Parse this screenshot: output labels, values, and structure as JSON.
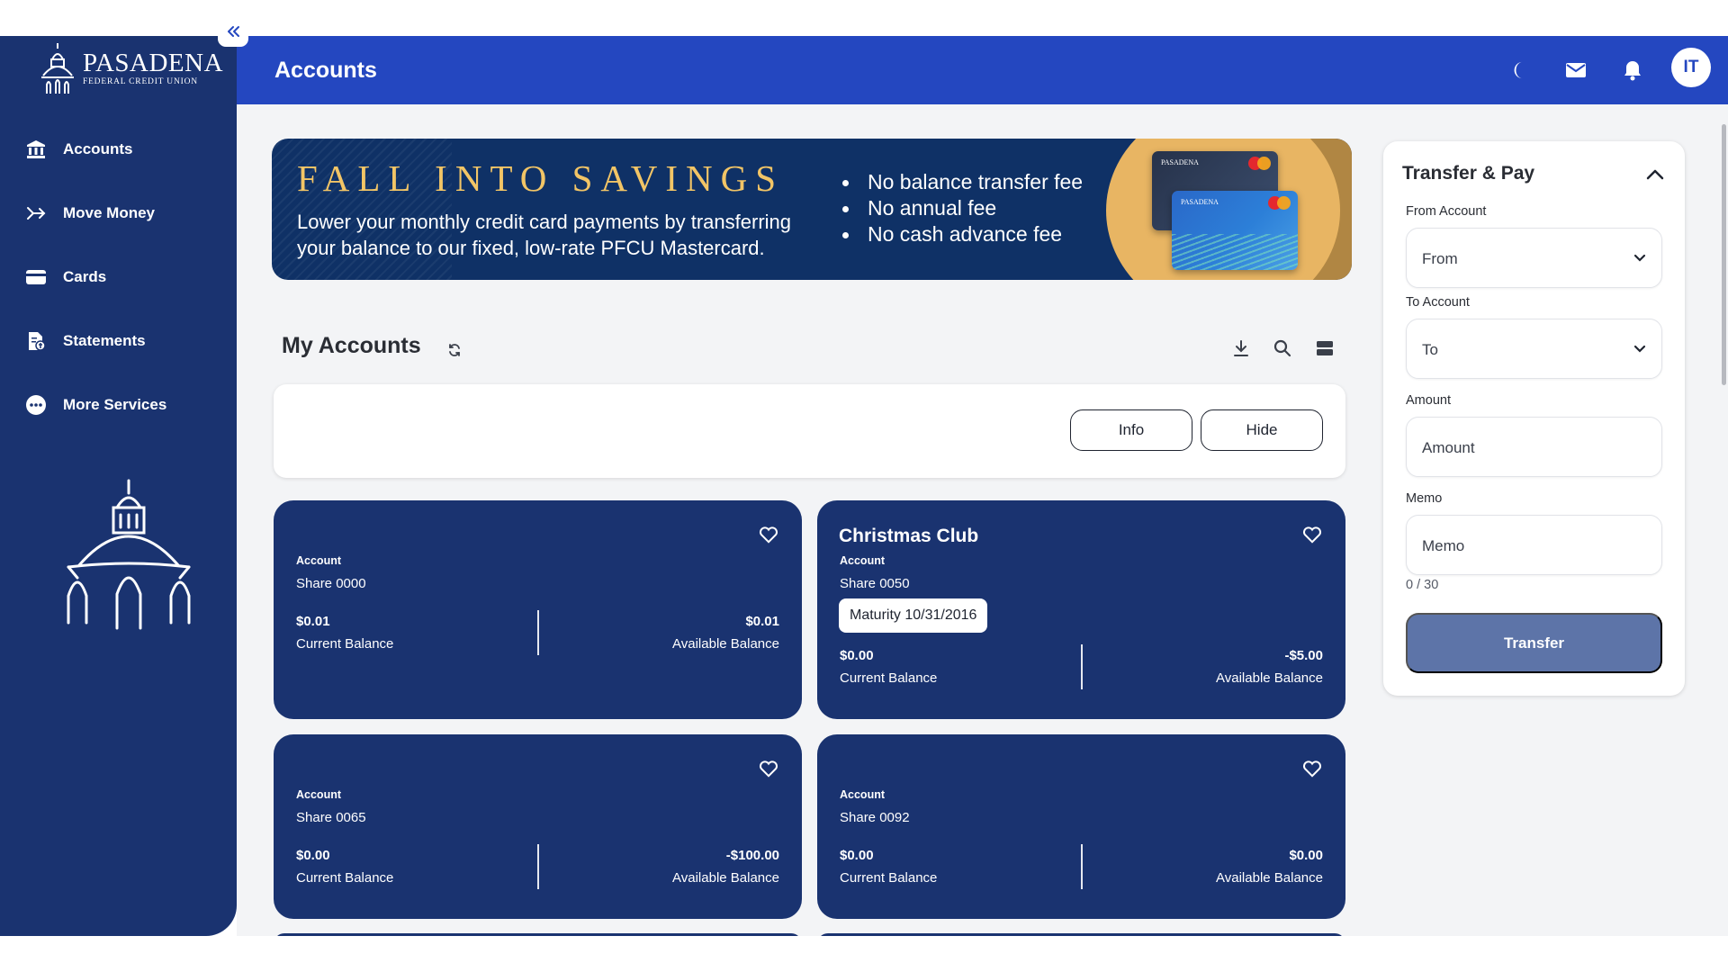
{
  "brand": {
    "name": "PASADENA",
    "tagline": "FEDERAL CREDIT UNION"
  },
  "sidebar": {
    "items": [
      {
        "label": "Accounts",
        "icon": "bank-icon"
      },
      {
        "label": "Move Money",
        "icon": "move-money-icon"
      },
      {
        "label": "Cards",
        "icon": "credit-card-icon"
      },
      {
        "label": "Statements",
        "icon": "statement-icon"
      },
      {
        "label": "More Services",
        "icon": "more-icon"
      }
    ]
  },
  "header": {
    "title": "Accounts",
    "avatar_initials": "IT",
    "icons": [
      "dark-mode-icon",
      "mail-icon",
      "bell-icon"
    ]
  },
  "banner": {
    "headline": "FALL INTO SAVINGS",
    "subtext": "Lower your monthly credit card payments by transferring your balance to our fixed, low-rate PFCU Mastercard.",
    "bullets": [
      "No balance transfer fee",
      "No annual fee",
      "No cash advance fee"
    ],
    "card_brand": "PASADENA"
  },
  "my_accounts": {
    "title": "My Accounts",
    "info_label": "Info",
    "hide_label": "Hide",
    "accounts": [
      {
        "name": "",
        "type_label": "Account",
        "number": "Share 0000",
        "maturity": "",
        "current_balance": "$0.01",
        "current_label": "Current Balance",
        "available_balance": "$0.01",
        "available_label": "Available Balance"
      },
      {
        "name": "Christmas Club",
        "type_label": "Account",
        "number": "Share 0050",
        "maturity": "Maturity 10/31/2016",
        "current_balance": "$0.00",
        "current_label": "Current Balance",
        "available_balance": "-$5.00",
        "available_label": "Available Balance"
      },
      {
        "name": "",
        "type_label": "Account",
        "number": "Share 0065",
        "maturity": "",
        "current_balance": "$0.00",
        "current_label": "Current Balance",
        "available_balance": "-$100.00",
        "available_label": "Available Balance"
      },
      {
        "name": "",
        "type_label": "Account",
        "number": "Share 0092",
        "maturity": "",
        "current_balance": "$0.00",
        "current_label": "Current Balance",
        "available_balance": "$0.00",
        "available_label": "Available Balance"
      }
    ]
  },
  "transfer": {
    "title": "Transfer & Pay",
    "from_label": "From Account",
    "from_value": "From",
    "to_label": "To Account",
    "to_value": "To",
    "amount_label": "Amount",
    "amount_placeholder": "Amount",
    "memo_label": "Memo",
    "memo_placeholder": "Memo",
    "memo_count": "0 / 30",
    "button_label": "Transfer"
  },
  "colors": {
    "sidebar": "#1a3370",
    "header": "#2447c0",
    "card": "#1a3370",
    "banner_gold": "#f2c566",
    "transfer_button": "#5d74a8"
  }
}
